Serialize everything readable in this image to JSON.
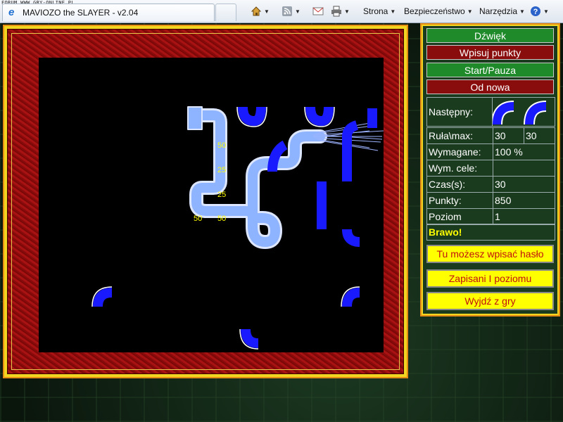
{
  "browser": {
    "forum_watermark": "FORUM WWW.GRY-ONLINE.PL",
    "tab_title": "MAVIOZO the SLAYER - v2.04",
    "menu": {
      "strona": "Strona",
      "bezpieczenstwo": "Bezpieczeństwo",
      "narzedzia": "Narzędzia"
    }
  },
  "panel": {
    "buttons": {
      "sound": "Dźwięk",
      "write_points": "Wpisuj punkty",
      "start_pause": "Start/Pauza",
      "restart": "Od nowa"
    },
    "next_label": "Następny:",
    "stats": {
      "pipes_label": "Ruła\\max:",
      "pipes_value": "30",
      "pipes_max": "30",
      "required_label": "Wymagane:",
      "required_value": "100 %",
      "targets_label": "Wym. cele:",
      "targets_value": "",
      "time_label": "Czas(s):",
      "time_value": "30",
      "points_label": "Punkty:",
      "points_value": "850",
      "level_label": "Poziom",
      "level_value": "1"
    },
    "message": "Brawo!",
    "password_button": "Tu możesz wpisać hasło",
    "saved_button": "Zapisani I poziomu",
    "exit_button": "Wyjdź z gry"
  },
  "board": {
    "score_labels": [
      "50",
      "25",
      "25",
      "50",
      "50"
    ]
  },
  "colors": {
    "pipe_blue": "#1a1aff",
    "pipe_filled": "#8fb4ff",
    "felt_red": "#a81212",
    "frame_yellow": "#f2d520"
  }
}
